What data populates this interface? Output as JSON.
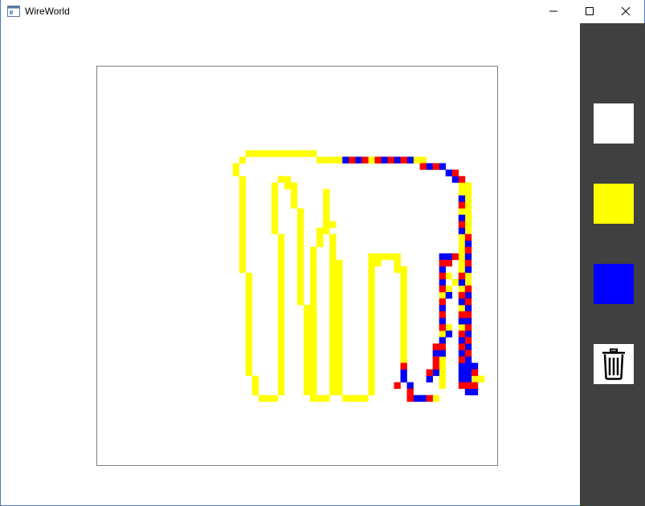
{
  "window": {
    "title": "WireWorld"
  },
  "palette": {
    "empty": "#ffffff",
    "conductor": "#ffff00",
    "electron_head": "#0000ff",
    "electron_tail": "#ff0000"
  },
  "tools": [
    {
      "name": "empty",
      "color": "#ffffff"
    },
    {
      "name": "conductor",
      "color": "#ffff00"
    },
    {
      "name": "electron-head",
      "color": "#0000ff"
    },
    {
      "name": "clear",
      "icon": "trash-icon"
    }
  ],
  "grid": {
    "cells": 62,
    "conductor_cells": [
      [
        23,
        13
      ],
      [
        24,
        13
      ],
      [
        25,
        13
      ],
      [
        26,
        13
      ],
      [
        27,
        13
      ],
      [
        28,
        13
      ],
      [
        29,
        13
      ],
      [
        30,
        13
      ],
      [
        31,
        13
      ],
      [
        32,
        13
      ],
      [
        33,
        13
      ],
      [
        22,
        14
      ],
      [
        34,
        14
      ],
      [
        35,
        14
      ],
      [
        36,
        14
      ],
      [
        37,
        14
      ],
      [
        21,
        15
      ],
      [
        21,
        16
      ],
      [
        22,
        17
      ],
      [
        22,
        18
      ],
      [
        22,
        19
      ],
      [
        22,
        20
      ],
      [
        22,
        21
      ],
      [
        22,
        22
      ],
      [
        22,
        23
      ],
      [
        22,
        24
      ],
      [
        22,
        25
      ],
      [
        22,
        26
      ],
      [
        22,
        27
      ],
      [
        22,
        28
      ],
      [
        22,
        29
      ],
      [
        22,
        30
      ],
      [
        22,
        31
      ],
      [
        23,
        32
      ],
      [
        23,
        33
      ],
      [
        23,
        34
      ],
      [
        23,
        35
      ],
      [
        23,
        36
      ],
      [
        23,
        37
      ],
      [
        23,
        38
      ],
      [
        23,
        39
      ],
      [
        23,
        40
      ],
      [
        23,
        41
      ],
      [
        23,
        42
      ],
      [
        23,
        43
      ],
      [
        23,
        44
      ],
      [
        23,
        45
      ],
      [
        23,
        46
      ],
      [
        23,
        47
      ],
      [
        24,
        48
      ],
      [
        24,
        49
      ],
      [
        24,
        50
      ],
      [
        25,
        51
      ],
      [
        26,
        51
      ],
      [
        27,
        51
      ],
      [
        28,
        49
      ],
      [
        28,
        50
      ],
      [
        28,
        48
      ],
      [
        28,
        47
      ],
      [
        28,
        46
      ],
      [
        28,
        45
      ],
      [
        28,
        44
      ],
      [
        28,
        43
      ],
      [
        28,
        42
      ],
      [
        28,
        41
      ],
      [
        28,
        40
      ],
      [
        28,
        39
      ],
      [
        28,
        38
      ],
      [
        28,
        37
      ],
      [
        28,
        36
      ],
      [
        28,
        35
      ],
      [
        28,
        34
      ],
      [
        28,
        33
      ],
      [
        28,
        32
      ],
      [
        28,
        31
      ],
      [
        28,
        30
      ],
      [
        28,
        29
      ],
      [
        28,
        28
      ],
      [
        28,
        27
      ],
      [
        28,
        26
      ],
      [
        27,
        25
      ],
      [
        27,
        24
      ],
      [
        27,
        23
      ],
      [
        27,
        22
      ],
      [
        27,
        21
      ],
      [
        27,
        20
      ],
      [
        27,
        19
      ],
      [
        27,
        18
      ],
      [
        28,
        17
      ],
      [
        29,
        17
      ],
      [
        29,
        18
      ],
      [
        30,
        18
      ],
      [
        30,
        19
      ],
      [
        30,
        20
      ],
      [
        30,
        21
      ],
      [
        31,
        22
      ],
      [
        31,
        23
      ],
      [
        31,
        24
      ],
      [
        31,
        25
      ],
      [
        31,
        26
      ],
      [
        31,
        27
      ],
      [
        31,
        28
      ],
      [
        31,
        29
      ],
      [
        31,
        30
      ],
      [
        31,
        31
      ],
      [
        31,
        32
      ],
      [
        31,
        33
      ],
      [
        31,
        34
      ],
      [
        31,
        35
      ],
      [
        31,
        36
      ],
      [
        32,
        37
      ],
      [
        32,
        38
      ],
      [
        32,
        39
      ],
      [
        32,
        40
      ],
      [
        32,
        41
      ],
      [
        32,
        42
      ],
      [
        32,
        43
      ],
      [
        32,
        44
      ],
      [
        32,
        45
      ],
      [
        32,
        46
      ],
      [
        32,
        47
      ],
      [
        32,
        48
      ],
      [
        32,
        49
      ],
      [
        32,
        50
      ],
      [
        33,
        51
      ],
      [
        34,
        51
      ],
      [
        35,
        51
      ],
      [
        36,
        50
      ],
      [
        36,
        49
      ],
      [
        36,
        48
      ],
      [
        36,
        47
      ],
      [
        36,
        46
      ],
      [
        36,
        45
      ],
      [
        36,
        44
      ],
      [
        36,
        43
      ],
      [
        36,
        42
      ],
      [
        36,
        41
      ],
      [
        36,
        40
      ],
      [
        36,
        39
      ],
      [
        36,
        38
      ],
      [
        36,
        37
      ],
      [
        36,
        36
      ],
      [
        36,
        35
      ],
      [
        36,
        34
      ],
      [
        36,
        33
      ],
      [
        36,
        32
      ],
      [
        36,
        31
      ],
      [
        36,
        30
      ],
      [
        36,
        29
      ],
      [
        36,
        28
      ],
      [
        36,
        27
      ],
      [
        36,
        26
      ],
      [
        35,
        25
      ],
      [
        35,
        24
      ],
      [
        35,
        23
      ],
      [
        35,
        22
      ],
      [
        35,
        21
      ],
      [
        35,
        20
      ],
      [
        35,
        19
      ],
      [
        33,
        28
      ],
      [
        33,
        29
      ],
      [
        33,
        30
      ],
      [
        33,
        31
      ],
      [
        33,
        32
      ],
      [
        33,
        33
      ],
      [
        33,
        34
      ],
      [
        33,
        35
      ],
      [
        33,
        36
      ],
      [
        33,
        37
      ],
      [
        33,
        38
      ],
      [
        33,
        39
      ],
      [
        33,
        40
      ],
      [
        33,
        41
      ],
      [
        33,
        42
      ],
      [
        33,
        43
      ],
      [
        33,
        44
      ],
      [
        33,
        45
      ],
      [
        33,
        46
      ],
      [
        33,
        47
      ],
      [
        33,
        48
      ],
      [
        33,
        49
      ],
      [
        33,
        50
      ],
      [
        34,
        27
      ],
      [
        34,
        26
      ],
      [
        34,
        25
      ],
      [
        35,
        25
      ],
      [
        36,
        24
      ],
      [
        37,
        30
      ],
      [
        37,
        31
      ],
      [
        37,
        32
      ],
      [
        37,
        33
      ],
      [
        37,
        34
      ],
      [
        37,
        35
      ],
      [
        37,
        36
      ],
      [
        37,
        37
      ],
      [
        37,
        38
      ],
      [
        37,
        39
      ],
      [
        37,
        40
      ],
      [
        37,
        41
      ],
      [
        37,
        42
      ],
      [
        37,
        43
      ],
      [
        37,
        44
      ],
      [
        37,
        45
      ],
      [
        37,
        46
      ],
      [
        37,
        47
      ],
      [
        37,
        48
      ],
      [
        37,
        49
      ],
      [
        37,
        50
      ],
      [
        38,
        51
      ],
      [
        39,
        51
      ],
      [
        40,
        51
      ],
      [
        41,
        51
      ],
      [
        42,
        49
      ],
      [
        42,
        50
      ],
      [
        42,
        48
      ],
      [
        42,
        47
      ],
      [
        42,
        46
      ],
      [
        42,
        45
      ],
      [
        42,
        44
      ],
      [
        42,
        43
      ],
      [
        42,
        42
      ],
      [
        42,
        41
      ],
      [
        42,
        40
      ],
      [
        42,
        39
      ],
      [
        42,
        38
      ],
      [
        42,
        37
      ],
      [
        42,
        36
      ],
      [
        42,
        35
      ],
      [
        42,
        34
      ],
      [
        42,
        33
      ],
      [
        42,
        32
      ],
      [
        42,
        31
      ],
      [
        42,
        30
      ],
      [
        42,
        29
      ],
      [
        43,
        29
      ],
      [
        43,
        30
      ],
      [
        44,
        29
      ],
      [
        45,
        29
      ],
      [
        46,
        29
      ],
      [
        47,
        31
      ],
      [
        47,
        32
      ],
      [
        47,
        33
      ],
      [
        47,
        34
      ],
      [
        47,
        35
      ],
      [
        47,
        36
      ],
      [
        47,
        37
      ],
      [
        47,
        38
      ],
      [
        47,
        39
      ],
      [
        47,
        40
      ],
      [
        47,
        41
      ],
      [
        47,
        42
      ],
      [
        47,
        43
      ],
      [
        47,
        44
      ],
      [
        47,
        45
      ],
      [
        47,
        46
      ],
      [
        47,
        47
      ],
      [
        47,
        48
      ],
      [
        46,
        30
      ],
      [
        46,
        31
      ],
      [
        48,
        49
      ],
      [
        48,
        50
      ],
      [
        52,
        51
      ],
      [
        53,
        49
      ],
      [
        53,
        48
      ],
      [
        53,
        47
      ],
      [
        53,
        46
      ],
      [
        53,
        45
      ],
      [
        53,
        44
      ],
      [
        53,
        43
      ],
      [
        53,
        42
      ],
      [
        53,
        41
      ],
      [
        53,
        40
      ],
      [
        53,
        39
      ],
      [
        53,
        38
      ],
      [
        53,
        37
      ],
      [
        53,
        36
      ],
      [
        53,
        35
      ],
      [
        53,
        34
      ],
      [
        53,
        33
      ],
      [
        53,
        32
      ],
      [
        53,
        31
      ],
      [
        53,
        30
      ],
      [
        53,
        29
      ],
      [
        54,
        29
      ],
      [
        54,
        32
      ],
      [
        55,
        33
      ],
      [
        54,
        40
      ],
      [
        54,
        34
      ],
      [
        54,
        35
      ],
      [
        57,
        41
      ],
      [
        57,
        42
      ],
      [
        57,
        43
      ],
      [
        57,
        44
      ],
      [
        57,
        45
      ],
      [
        57,
        46
      ],
      [
        57,
        47
      ],
      [
        57,
        48
      ],
      [
        57,
        49
      ],
      [
        57,
        50
      ],
      [
        56,
        39
      ],
      [
        56,
        40
      ],
      [
        56,
        38
      ],
      [
        56,
        37
      ],
      [
        56,
        36
      ],
      [
        56,
        35
      ],
      [
        56,
        34
      ],
      [
        56,
        33
      ],
      [
        56,
        32
      ],
      [
        56,
        31
      ],
      [
        56,
        30
      ],
      [
        56,
        29
      ],
      [
        56,
        28
      ],
      [
        56,
        27
      ],
      [
        56,
        26
      ],
      [
        56,
        25
      ],
      [
        56,
        24
      ],
      [
        56,
        23
      ],
      [
        56,
        22
      ],
      [
        56,
        21
      ],
      [
        56,
        20
      ],
      [
        56,
        19
      ],
      [
        56,
        18
      ],
      [
        57,
        18
      ],
      [
        57,
        19
      ],
      [
        57,
        20
      ],
      [
        57,
        21
      ],
      [
        57,
        22
      ],
      [
        57,
        23
      ],
      [
        57,
        24
      ],
      [
        57,
        25
      ],
      [
        57,
        26
      ],
      [
        57,
        27
      ],
      [
        57,
        28
      ],
      [
        57,
        29
      ],
      [
        57,
        30
      ],
      [
        57,
        31
      ],
      [
        57,
        32
      ],
      [
        57,
        33
      ],
      [
        57,
        34
      ],
      [
        57,
        35
      ],
      [
        57,
        36
      ],
      [
        57,
        37
      ],
      [
        57,
        38
      ],
      [
        57,
        39
      ],
      [
        57,
        40
      ],
      [
        55,
        17
      ],
      [
        54,
        16
      ],
      [
        53,
        15
      ],
      [
        52,
        15
      ],
      [
        51,
        15
      ],
      [
        50,
        14
      ],
      [
        49,
        14
      ],
      [
        48,
        14
      ],
      [
        47,
        14
      ],
      [
        46,
        14
      ],
      [
        45,
        14
      ],
      [
        44,
        14
      ],
      [
        43,
        14
      ],
      [
        42,
        14
      ],
      [
        41,
        14
      ],
      [
        40,
        14
      ],
      [
        39,
        14
      ],
      [
        38,
        14
      ],
      [
        58,
        47
      ],
      [
        58,
        48
      ],
      [
        59,
        48
      ]
    ],
    "head_cells": [
      [
        38,
        14
      ],
      [
        40,
        14
      ],
      [
        44,
        14
      ],
      [
        46,
        14
      ],
      [
        48,
        14
      ],
      [
        51,
        15
      ],
      [
        53,
        15
      ],
      [
        54,
        16
      ],
      [
        55,
        17
      ],
      [
        56,
        20
      ],
      [
        56,
        23
      ],
      [
        56,
        25
      ],
      [
        57,
        27
      ],
      [
        57,
        29
      ],
      [
        57,
        31
      ],
      [
        57,
        35
      ],
      [
        57,
        37
      ],
      [
        57,
        39
      ],
      [
        57,
        41
      ],
      [
        57,
        43
      ],
      [
        57,
        45
      ],
      [
        56,
        33
      ],
      [
        56,
        36
      ],
      [
        56,
        39
      ],
      [
        56,
        42
      ],
      [
        56,
        44
      ],
      [
        56,
        46
      ],
      [
        56,
        47
      ],
      [
        56,
        48
      ],
      [
        57,
        46
      ],
      [
        57,
        47
      ],
      [
        57,
        48
      ],
      [
        58,
        46
      ],
      [
        58,
        50
      ],
      [
        57,
        50
      ],
      [
        53,
        29
      ],
      [
        54,
        29
      ],
      [
        53,
        31
      ],
      [
        53,
        33
      ],
      [
        54,
        35
      ],
      [
        53,
        37
      ],
      [
        53,
        39
      ],
      [
        54,
        41
      ],
      [
        53,
        42
      ],
      [
        53,
        44
      ],
      [
        52,
        44
      ],
      [
        52,
        47
      ],
      [
        51,
        48
      ],
      [
        49,
        51
      ],
      [
        50,
        51
      ],
      [
        47,
        47
      ],
      [
        47,
        48
      ],
      [
        48,
        49
      ]
    ],
    "tail_cells": [
      [
        39,
        14
      ],
      [
        41,
        14
      ],
      [
        43,
        14
      ],
      [
        45,
        14
      ],
      [
        47,
        14
      ],
      [
        50,
        15
      ],
      [
        52,
        15
      ],
      [
        55,
        16
      ],
      [
        56,
        17
      ],
      [
        56,
        21
      ],
      [
        56,
        24
      ],
      [
        57,
        26
      ],
      [
        57,
        28
      ],
      [
        57,
        30
      ],
      [
        57,
        34
      ],
      [
        57,
        36
      ],
      [
        57,
        38
      ],
      [
        57,
        40
      ],
      [
        57,
        42
      ],
      [
        57,
        44
      ],
      [
        56,
        32
      ],
      [
        56,
        35
      ],
      [
        56,
        38
      ],
      [
        56,
        41
      ],
      [
        56,
        43
      ],
      [
        56,
        45
      ],
      [
        58,
        47
      ],
      [
        57,
        49
      ],
      [
        58,
        49
      ],
      [
        56,
        49
      ],
      [
        55,
        29
      ],
      [
        54,
        30
      ],
      [
        53,
        30
      ],
      [
        53,
        32
      ],
      [
        53,
        34
      ],
      [
        53,
        36
      ],
      [
        53,
        38
      ],
      [
        53,
        40
      ],
      [
        53,
        43
      ],
      [
        52,
        43
      ],
      [
        52,
        45
      ],
      [
        52,
        46
      ],
      [
        51,
        47
      ],
      [
        48,
        50
      ],
      [
        48,
        51
      ],
      [
        51,
        51
      ],
      [
        47,
        46
      ],
      [
        46,
        49
      ]
    ]
  }
}
